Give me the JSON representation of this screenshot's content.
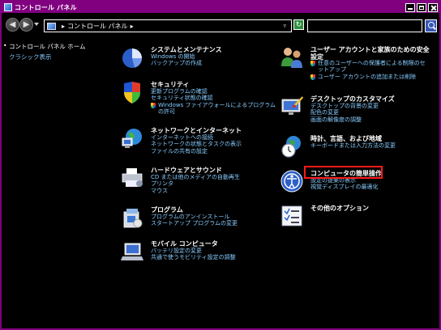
{
  "window": {
    "title": "コントロール パネル"
  },
  "address": {
    "crumb": "コントロール パネル",
    "dropdown": "▿"
  },
  "search": {
    "placeholder": ""
  },
  "leftnav": {
    "home": "コントロール パネル ホーム",
    "classic": "クラシック表示"
  },
  "categories": [
    {
      "title": "システムとメンテナンス",
      "links": [
        "Windows の開始",
        "バックアップの作成"
      ]
    },
    {
      "title": "セキュリティ",
      "links": [
        "更新プログラムの確認",
        "セキュリティ状態の確認",
        "Windows ファイアウォールによるプログラム",
        "の許可"
      ]
    },
    {
      "title": "ネットワークとインターネット",
      "links": [
        "インターネットへの接続",
        "ネットワークの状態とタスクの表示",
        "ファイルの共有の設定"
      ]
    },
    {
      "title": "ハードウェアとサウンド",
      "links": [
        "CD または他のメディアの自動再生",
        "プリンタ",
        "マウス"
      ]
    },
    {
      "title": "プログラム",
      "links": [
        "プログラムのアンインストール",
        "スタートアップ プログラムの変更"
      ]
    },
    {
      "title": "モバイル コンピュータ",
      "links": [
        "バッテリ設定の変更",
        "共通で使うモビリティ設定の調整"
      ]
    },
    {
      "title": "ユーザー アカウントと家族のための安全",
      "title2": "設定",
      "links": [
        "任意のユーザーへの保護者による制限のセ",
        "ットアップ",
        "ユーザー アカウントの追加または削除"
      ]
    },
    {
      "title": "デスクトップのカスタマイズ",
      "links": [
        "デスクトップの背景の変更",
        "配色の変更",
        "画面の解像度の調整"
      ]
    },
    {
      "title": "時計、言語、および地域",
      "links": [
        "キーボードまたは入力方法の変更"
      ]
    },
    {
      "title": "コンピュータの簡単操作",
      "links": [
        "設定の提案の表示",
        "視覚ディスプレイの最適化"
      ]
    },
    {
      "title": "その他のオプション",
      "links": []
    }
  ],
  "colors": {
    "frame": "#800080",
    "link": "#88ccff",
    "highlight": "#ff1a1a"
  }
}
